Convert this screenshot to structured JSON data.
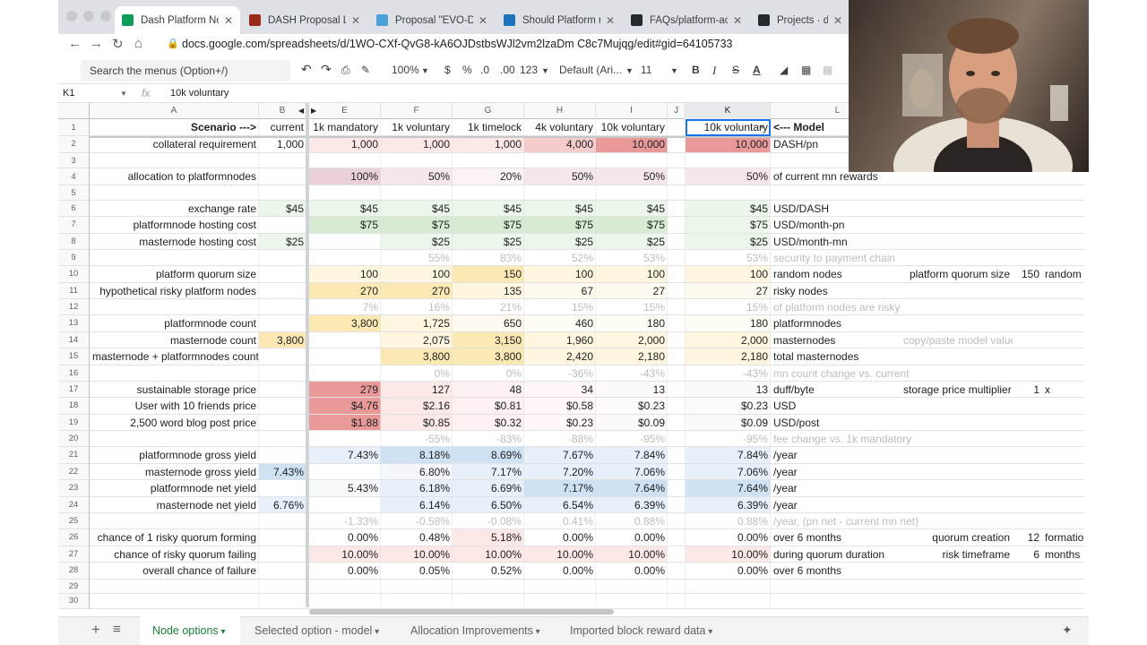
{
  "browser": {
    "tabs": [
      {
        "label": "Dash Platform Node",
        "active": true,
        "color": "#0f9d58"
      },
      {
        "label": "DASH Proposal Lea",
        "active": false,
        "color": "#9c2b1a"
      },
      {
        "label": "Proposal \"EVO-DEC",
        "active": false,
        "color": "#4aa0d8"
      },
      {
        "label": "Should Platform ru",
        "active": false,
        "color": "#1c75bc"
      },
      {
        "label": "FAQs/platform-activ",
        "active": false,
        "color": "#24292e"
      },
      {
        "label": "Projects · dashhive",
        "active": false,
        "color": "#24292e"
      }
    ],
    "url": "docs.google.com/spreadsheets/d/1WO-CXf-QvG8-kA6OJDstbsWJl2vm2lzaDm C8c7Mujqg/edit#gid=64105733"
  },
  "toolbar": {
    "search_placeholder": "Search the menus (Option+/)",
    "zoom": "100%",
    "currency": "$",
    "percent": "%",
    "decimals_less": ".0",
    "decimals_more": ".00",
    "format": "123",
    "font": "Default (Ari...",
    "font_size": "11",
    "bold": "B",
    "italic": "I",
    "strike": "S",
    "text_color": "A"
  },
  "formula_bar": {
    "cell": "K1",
    "fx": "fx",
    "content": "10k voluntary"
  },
  "columns": [
    "A",
    "B",
    "E",
    "F",
    "G",
    "H",
    "I",
    "J",
    "K",
    "L"
  ],
  "rows": [
    {
      "n": "1",
      "a": "Scenario --->",
      "b": "current",
      "e": "1k mandatory",
      "f": "1k voluntary",
      "g": "1k timelock",
      "h": "4k voluntary",
      "i": "10k voluntary",
      "k": "10k voluntary",
      "l": "<--- Model"
    },
    {
      "n": "2",
      "a": "collateral requirement",
      "b": "1,000",
      "e": "1,000",
      "f": "1,000",
      "g": "1,000",
      "h": "4,000",
      "i": "10,000",
      "k": "10,000",
      "l": "DASH/pn"
    },
    {
      "n": "3"
    },
    {
      "n": "4",
      "a": "allocation to platformnodes",
      "e": "100%",
      "f": "50%",
      "g": "20%",
      "h": "50%",
      "i": "50%",
      "k": "50%",
      "l": "of current mn rewards"
    },
    {
      "n": "5"
    },
    {
      "n": "6",
      "a": "exchange rate",
      "b": "$45",
      "e": "$45",
      "f": "$45",
      "g": "$45",
      "h": "$45",
      "i": "$45",
      "k": "$45",
      "l": "USD/DASH"
    },
    {
      "n": "7",
      "a": "platformnode hosting cost",
      "e": "$75",
      "f": "$75",
      "g": "$75",
      "h": "$75",
      "i": "$75",
      "k": "$75",
      "l": "USD/month-pn"
    },
    {
      "n": "8",
      "a": "masternode hosting cost",
      "b": "$25",
      "f": "$25",
      "g": "$25",
      "h": "$25",
      "i": "$25",
      "k": "$25",
      "l": "USD/month-mn"
    },
    {
      "n": "9",
      "f": "55%",
      "g": "83%",
      "h": "52%",
      "i": "53%",
      "k": "53%",
      "l": "security to payment chain"
    },
    {
      "n": "10",
      "a": "platform quorum size",
      "e": "100",
      "f": "100",
      "g": "150",
      "h": "100",
      "i": "100",
      "k": "100",
      "l": "random nodes",
      "extra1": "platform quorum size",
      "extra2": "150",
      "extra3": "random"
    },
    {
      "n": "11",
      "a": "hypothetical risky platform nodes",
      "e": "270",
      "f": "270",
      "g": "135",
      "h": "67",
      "i": "27",
      "k": "27",
      "l": "risky nodes"
    },
    {
      "n": "12",
      "e": "7%",
      "f": "16%",
      "g": "21%",
      "h": "15%",
      "i": "15%",
      "k": "15%",
      "l": "of platform nodes are risky"
    },
    {
      "n": "13",
      "a": "platformnode count",
      "e": "3,800",
      "f": "1,725",
      "g": "650",
      "h": "460",
      "i": "180",
      "k": "180",
      "l": "platformnodes"
    },
    {
      "n": "14",
      "a": "masternode count",
      "b": "3,800",
      "f": "2,075",
      "g": "3,150",
      "h": "1,960",
      "i": "2,000",
      "k": "2,000",
      "l": "masternodes",
      "extra1": "copy/paste model values from this line"
    },
    {
      "n": "15",
      "a": "masternode + platformnodes count",
      "f": "3,800",
      "g": "3,800",
      "h": "2,420",
      "i": "2,180",
      "k": "2,180",
      "l": "total masternodes"
    },
    {
      "n": "16",
      "f": "0%",
      "g": "0%",
      "h": "-36%",
      "i": "-43%",
      "k": "-43%",
      "l": "mn count change vs. current"
    },
    {
      "n": "17",
      "a": "sustainable storage price",
      "e": "279",
      "f": "127",
      "g": "48",
      "h": "34",
      "i": "13",
      "k": "13",
      "l": "duff/byte",
      "extra1": "storage price multiplier",
      "extra2": "1",
      "extra3": "x"
    },
    {
      "n": "18",
      "a": "User with 10 friends price",
      "e": "$4.76",
      "f": "$2.16",
      "g": "$0.81",
      "h": "$0.58",
      "i": "$0.23",
      "k": "$0.23",
      "l": "USD"
    },
    {
      "n": "19",
      "a": "2,500 word blog post price",
      "e": "$1.88",
      "f": "$0.85",
      "g": "$0.32",
      "h": "$0.23",
      "i": "$0.09",
      "k": "$0.09",
      "l": "USD/post"
    },
    {
      "n": "20",
      "f": "-55%",
      "g": "-83%",
      "h": "-88%",
      "i": "-95%",
      "k": "-95%",
      "l": "fee change vs. 1k mandatory"
    },
    {
      "n": "21",
      "a": "platformnode gross yield",
      "e": "7.43%",
      "f": "8.18%",
      "g": "8.69%",
      "h": "7.67%",
      "i": "7.84%",
      "k": "7.84%",
      "l": "/year"
    },
    {
      "n": "22",
      "a": "masternode gross yield",
      "b": "7.43%",
      "f": "6.80%",
      "g": "7.17%",
      "h": "7.20%",
      "i": "7.06%",
      "k": "7.06%",
      "l": "/year"
    },
    {
      "n": "23",
      "a": "platformnode net yield",
      "e": "5.43%",
      "f": "6.18%",
      "g": "6.69%",
      "h": "7.17%",
      "i": "7.64%",
      "k": "7.64%",
      "l": "/year"
    },
    {
      "n": "24",
      "a": "masternode net yield",
      "b": "6.76%",
      "f": "6.14%",
      "g": "6.50%",
      "h": "6.54%",
      "i": "6.39%",
      "k": "6.39%",
      "l": "/year"
    },
    {
      "n": "25",
      "e": "-1.33%",
      "f": "-0.58%",
      "g": "-0.08%",
      "h": "0.41%",
      "i": "0.88%",
      "k": "0.88%",
      "l": "/year, (pn net - current mn net)"
    },
    {
      "n": "26",
      "a": "chance of 1 risky quorum forming",
      "e": "0.00%",
      "f": "0.48%",
      "g": "5.18%",
      "h": "0.00%",
      "i": "0.00%",
      "k": "0.00%",
      "l": "over 6 months",
      "extra1": "quorum creation",
      "extra2": "12",
      "extra3": "formatio"
    },
    {
      "n": "27",
      "a": "chance of risky quorum failing",
      "e": "10.00%",
      "f": "10.00%",
      "g": "10.00%",
      "h": "10.00%",
      "i": "10.00%",
      "k": "10.00%",
      "l": "during quorum duration",
      "extra1": "risk timeframe",
      "extra2": "6",
      "extra3": "months"
    },
    {
      "n": "28",
      "a": "overall chance of failure",
      "e": "0.00%",
      "f": "0.05%",
      "g": "0.52%",
      "h": "0.00%",
      "i": "0.00%",
      "k": "0.00%",
      "l": "over 6 months"
    },
    {
      "n": "29"
    },
    {
      "n": "30"
    }
  ],
  "sheet_tabs": [
    {
      "label": "Node options",
      "active": true
    },
    {
      "label": "Selected option - model",
      "active": false
    },
    {
      "label": "Allocation Improvements",
      "active": false
    },
    {
      "label": "Imported block reward data",
      "active": false
    }
  ],
  "colors": {
    "red_strong": "#ea9999",
    "red_soft": "#f4cccc",
    "red_faint": "#fce8e6",
    "green_soft": "#d9ead3",
    "green_faint": "#edf6ea",
    "yellow_soft": "#fce8b2",
    "yellow_faint": "#fef6de",
    "blue_soft": "#cfe2f3",
    "blue_faint": "#e8f0fa",
    "accent_green": "#188038",
    "selection_blue": "#1a73e8"
  }
}
